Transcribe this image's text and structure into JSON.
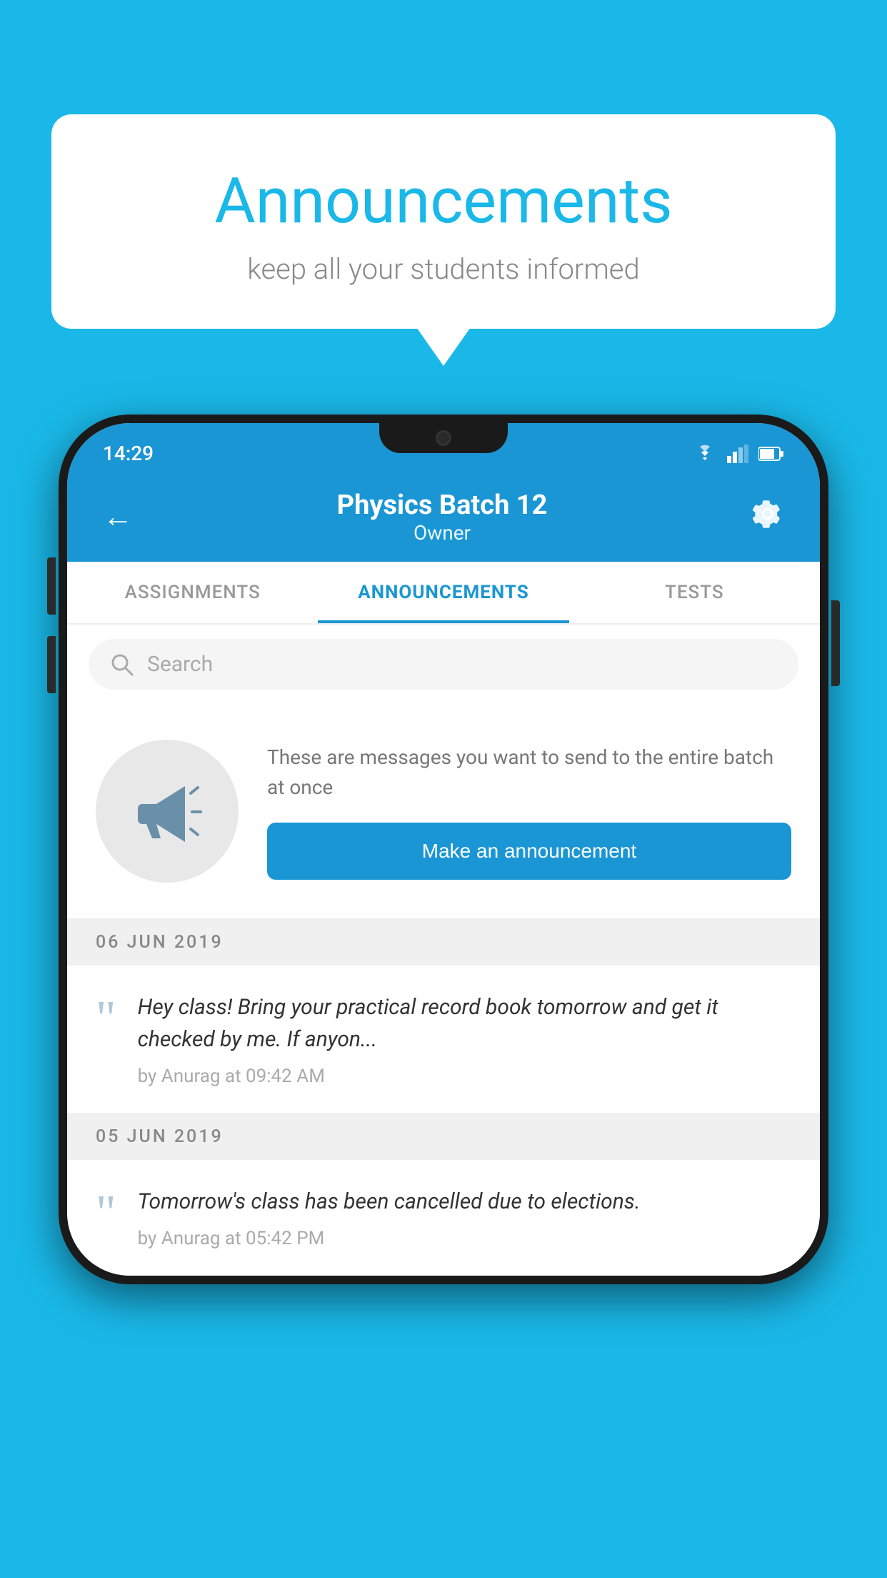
{
  "background_color": "#1ab8e8",
  "speech_bubble": {
    "title": "Announcements",
    "subtitle": "keep all your students informed"
  },
  "phone": {
    "status_bar": {
      "time": "14:29",
      "icons": [
        "wifi",
        "signal",
        "battery"
      ]
    },
    "app_bar": {
      "title": "Physics Batch 12",
      "subtitle": "Owner",
      "back_label": "←",
      "settings_label": "⚙"
    },
    "tabs": [
      {
        "label": "ASSIGNMENTS",
        "active": false
      },
      {
        "label": "ANNOUNCEMENTS",
        "active": true
      },
      {
        "label": "TESTS",
        "active": false
      }
    ],
    "search": {
      "placeholder": "Search"
    },
    "announcement_prompt": {
      "description": "These are messages you want to send to the entire batch at once",
      "button_label": "Make an announcement"
    },
    "announcements": [
      {
        "date": "06  JUN  2019",
        "text": "Hey class! Bring your practical record book tomorrow and get it checked by me. If anyon...",
        "meta": "by Anurag at 09:42 AM"
      },
      {
        "date": "05  JUN  2019",
        "text": "Tomorrow's class has been cancelled due to elections.",
        "meta": "by Anurag at 05:42 PM"
      }
    ]
  }
}
